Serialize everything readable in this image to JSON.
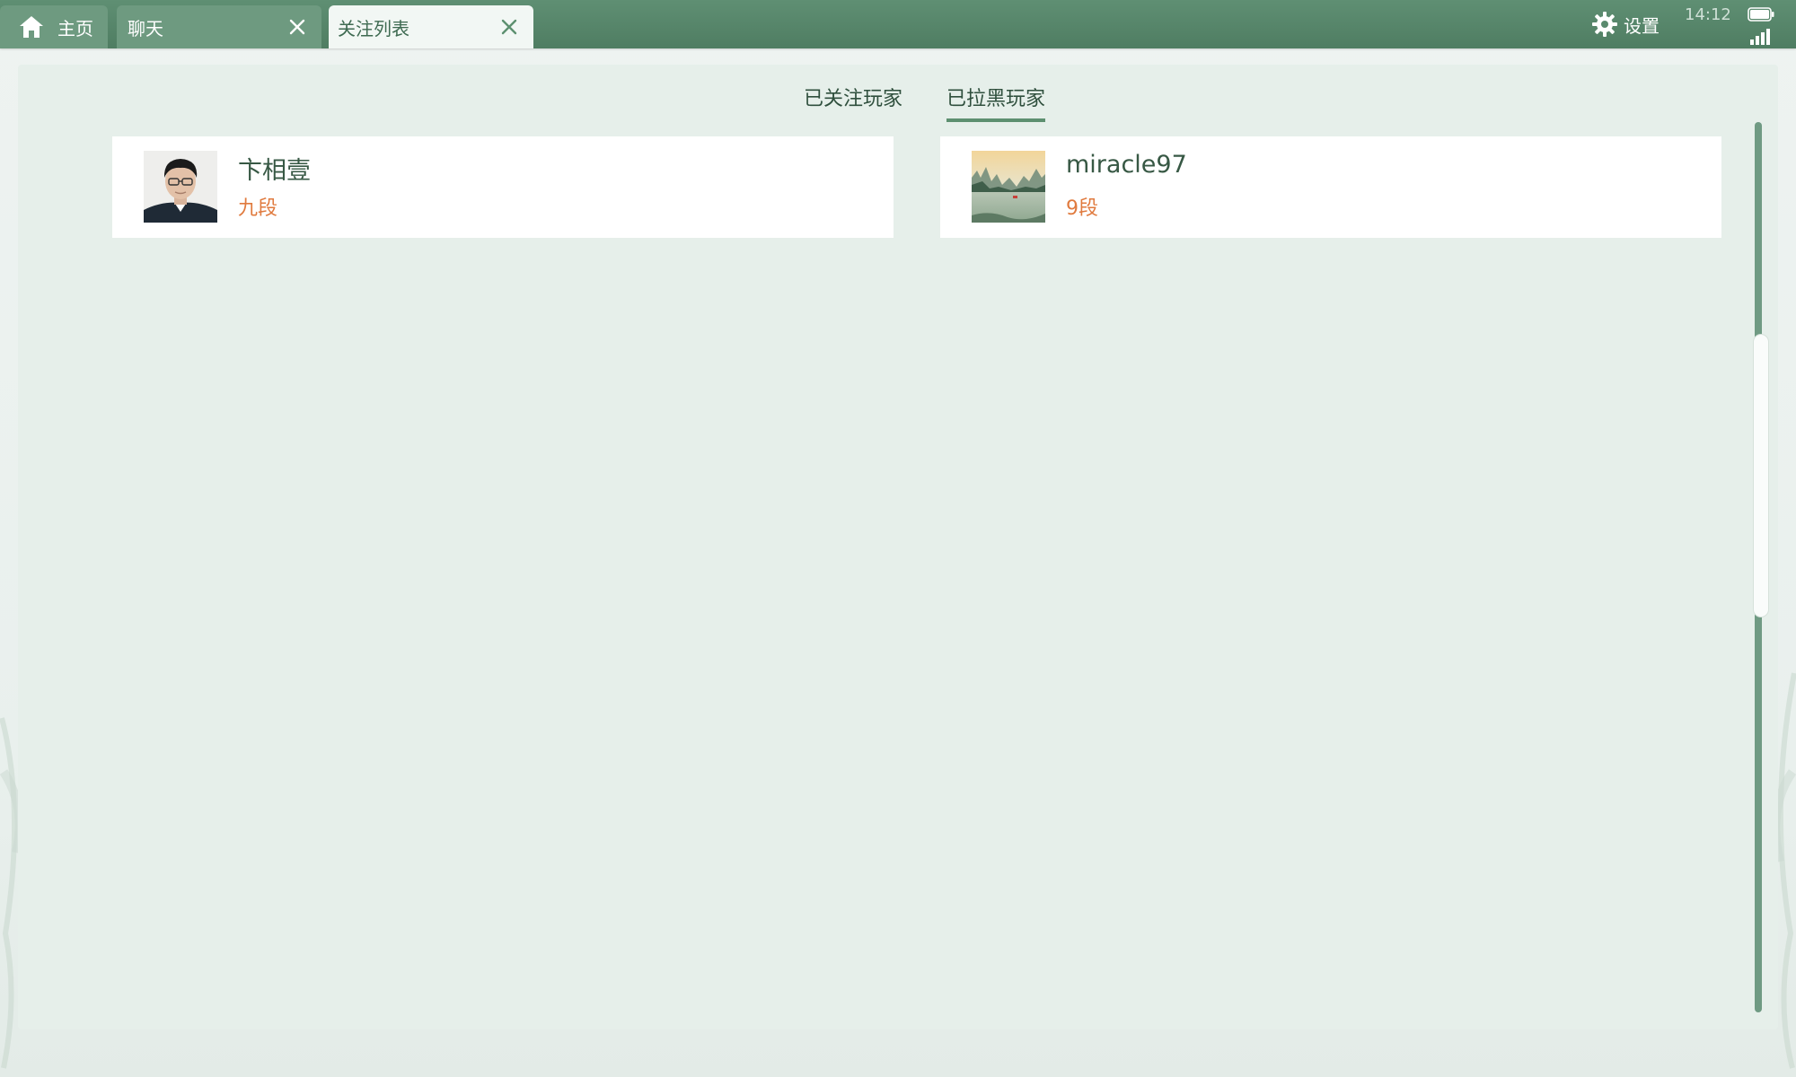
{
  "tabs": [
    {
      "label": "主页",
      "icon": "home-icon",
      "active": false,
      "closable": false
    },
    {
      "label": "聊天",
      "icon": null,
      "active": false,
      "closable": true
    },
    {
      "label": "关注列表",
      "icon": null,
      "active": true,
      "closable": true
    }
  ],
  "status": {
    "settings_label": "设置",
    "settings_icon": "gear-icon",
    "time": "14:12",
    "battery_icon": "battery-icon",
    "signal_icon": "signal-icon"
  },
  "segments": {
    "followed": "已关注玩家",
    "blocked": "已拉黑玩家",
    "selected": "blocked"
  },
  "players": [
    {
      "name": "卞相壹",
      "rank": "九段",
      "avatar": "person-photo"
    },
    {
      "name": "miracle97",
      "rank": "9段",
      "avatar": "landscape-photo"
    }
  ],
  "colors": {
    "topbar": "#5a8a6e",
    "accent": "#5d9070",
    "rank": "#e07a3e",
    "panel": "#e6efea"
  }
}
